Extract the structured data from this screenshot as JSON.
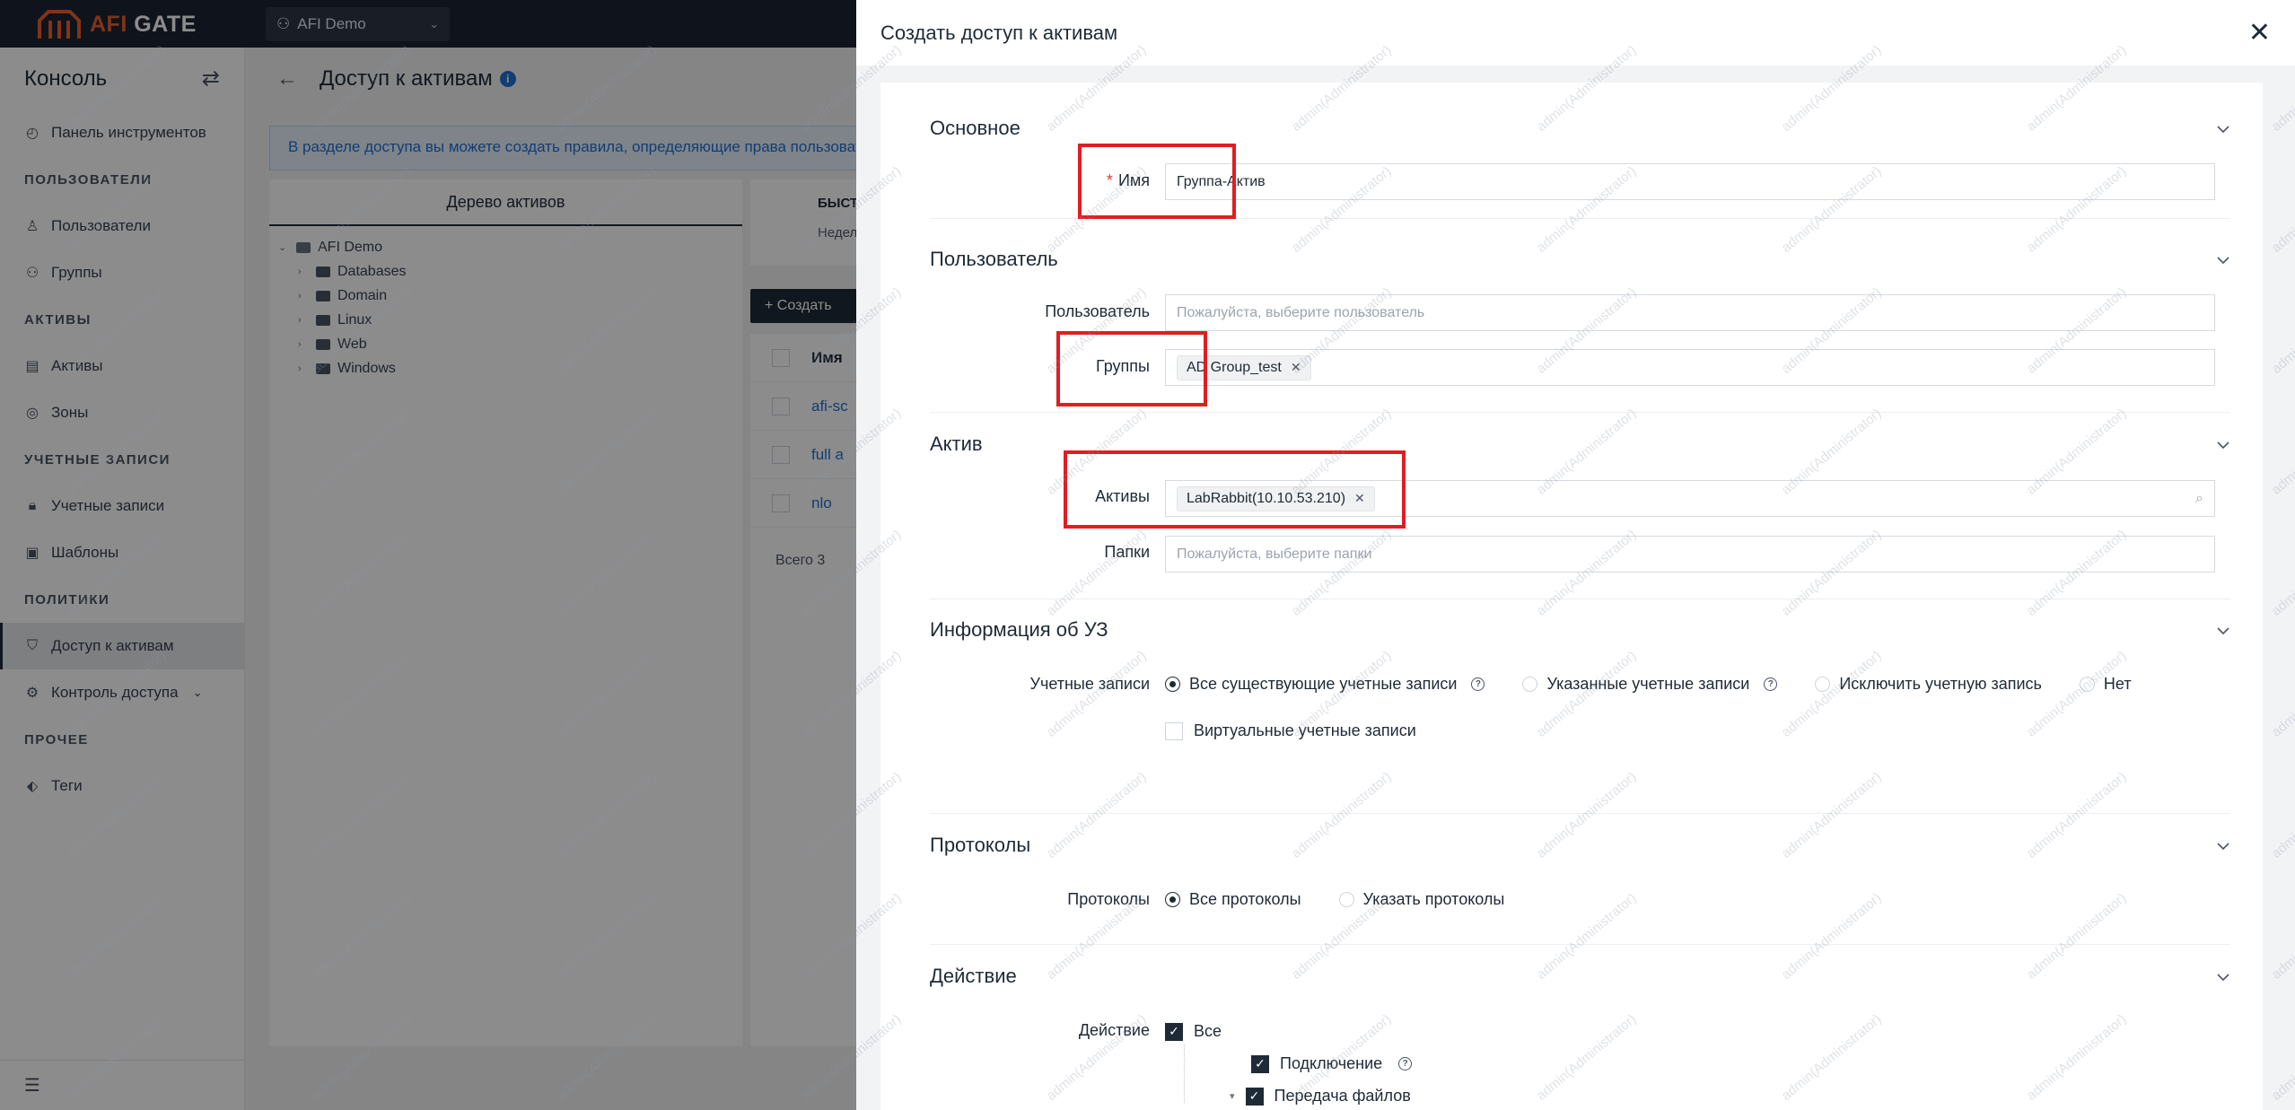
{
  "topbar": {
    "logo_prefix": "AFI",
    "logo_suffix": "GATE",
    "org": "AFI Demo"
  },
  "sidebar": {
    "title": "Консоль",
    "items": [
      {
        "type": "item",
        "label": "Панель инструментов",
        "icon": "dashboard-icon"
      },
      {
        "type": "section",
        "label": "ПОЛЬЗОВАТЕЛИ"
      },
      {
        "type": "item",
        "label": "Пользователи",
        "icon": "user-icon"
      },
      {
        "type": "item",
        "label": "Группы",
        "icon": "group-icon"
      },
      {
        "type": "section",
        "label": "АКТИВЫ"
      },
      {
        "type": "item",
        "label": "Активы",
        "icon": "server-icon"
      },
      {
        "type": "item",
        "label": "Зоны",
        "icon": "zone-icon"
      },
      {
        "type": "section",
        "label": "УЧЕТНЫЕ ЗАПИСИ"
      },
      {
        "type": "item",
        "label": "Учетные записи",
        "icon": "lock-icon"
      },
      {
        "type": "item",
        "label": "Шаблоны",
        "icon": "template-icon"
      },
      {
        "type": "section",
        "label": "ПОЛИТИКИ"
      },
      {
        "type": "item",
        "label": "Доступ к активам",
        "icon": "shield-icon",
        "active": true
      },
      {
        "type": "item",
        "label": "Контроль доступа",
        "icon": "gear-icon",
        "expandable": true
      },
      {
        "type": "section",
        "label": "ПРОЧЕЕ"
      },
      {
        "type": "item",
        "label": "Теги",
        "icon": "tag-icon"
      }
    ]
  },
  "page": {
    "title": "Доступ к активам",
    "banner": "В разделе доступа вы можете создать правила, определяющие права пользователей",
    "tree_title": "Дерево активов",
    "tree_root": "AFI Demo",
    "tree_children": [
      "Databases",
      "Domain",
      "Linux",
      "Web",
      "Windows"
    ],
    "quick_title": "БЫСТ",
    "quick_sub": "Недел",
    "create_label": "+ Создать",
    "list_header": "Имя",
    "list_rows": [
      "afi-sc",
      "full a",
      "nlo"
    ],
    "list_total": "Всего 3"
  },
  "drawer": {
    "title": "Создать доступ к активам",
    "basic": {
      "title": "Основное",
      "name_label": "Имя",
      "name_value": "Группа-Актив"
    },
    "user": {
      "title": "Пользователь",
      "user_label": "Пользователь",
      "user_placeholder": "Пожалуйста, выберите пользователь",
      "groups_label": "Группы",
      "groups_tag": "AD Group_test"
    },
    "asset": {
      "title": "Актив",
      "assets_label": "Активы",
      "assets_tag": "LabRabbit(10.10.53.210)",
      "folders_label": "Папки",
      "folders_placeholder": "Пожалуйста, выберите папки"
    },
    "account": {
      "title": "Информация об УЗ",
      "accounts_label": "Учетные записи",
      "options": [
        "Все существующие учетные записи",
        "Указанные учетные записи",
        "Исключить учетную запись",
        "Нет"
      ],
      "selected": 0,
      "virtual_label": "Виртуальные учетные записи"
    },
    "protocols": {
      "title": "Протоколы",
      "label": "Протоколы",
      "options": [
        "Все протоколы",
        "Указать протоколы"
      ],
      "selected": 0
    },
    "action": {
      "title": "Действие",
      "label": "Действие",
      "all": "Все",
      "connect": "Подключение",
      "file_transfer": "Передача файлов"
    }
  },
  "watermark": "admin(Administrator)",
  "colors": {
    "accent": "#1f2a37",
    "highlight": "#e11d22",
    "logo_orange": "#e8622a",
    "link": "#1f6fd1"
  }
}
